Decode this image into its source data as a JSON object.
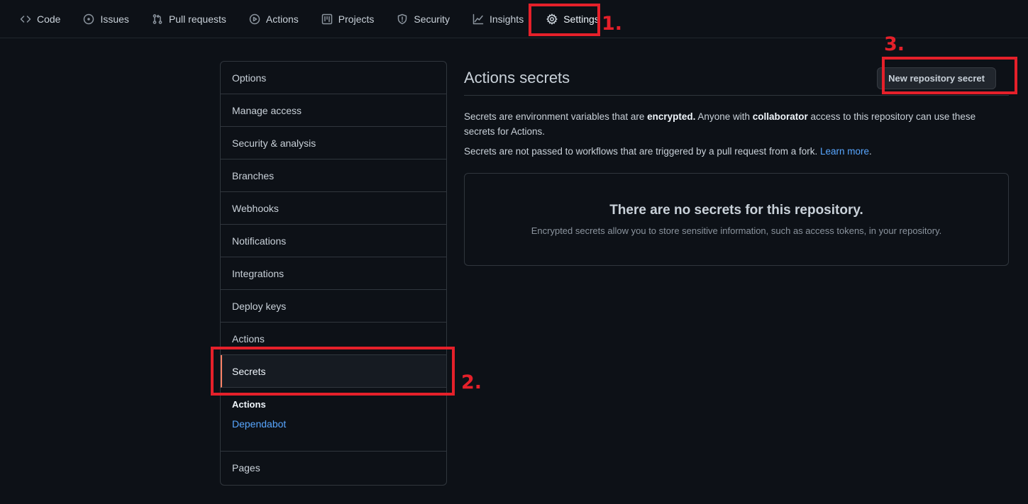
{
  "nav": {
    "tabs": [
      {
        "label": "Code",
        "icon": "code-icon"
      },
      {
        "label": "Issues",
        "icon": "issue-icon"
      },
      {
        "label": "Pull requests",
        "icon": "pull-request-icon"
      },
      {
        "label": "Actions",
        "icon": "play-icon"
      },
      {
        "label": "Projects",
        "icon": "project-icon"
      },
      {
        "label": "Security",
        "icon": "shield-icon"
      },
      {
        "label": "Insights",
        "icon": "graph-icon"
      },
      {
        "label": "Settings",
        "icon": "gear-icon",
        "active": true
      }
    ]
  },
  "annotations": {
    "step1": "1.",
    "step2": "2.",
    "step3": "3.",
    "color": "#e5202a"
  },
  "sidebar": {
    "items": [
      {
        "label": "Options"
      },
      {
        "label": "Manage access"
      },
      {
        "label": "Security & analysis"
      },
      {
        "label": "Branches"
      },
      {
        "label": "Webhooks"
      },
      {
        "label": "Notifications"
      },
      {
        "label": "Integrations"
      },
      {
        "label": "Deploy keys"
      },
      {
        "label": "Actions"
      },
      {
        "label": "Secrets",
        "selected": true
      }
    ],
    "group": {
      "title": "Actions",
      "sub": "Dependabot"
    },
    "last_item": "Pages"
  },
  "main": {
    "title": "Actions secrets",
    "new_button": "New repository secret",
    "desc": {
      "part1": "Secrets are environment variables that are ",
      "bold1": "encrypted.",
      "part2": " Anyone with ",
      "bold2": "collaborator",
      "part3": " access to this repository can use these secrets for Actions."
    },
    "desc2": {
      "text": "Secrets are not passed to workflows that are triggered by a pull request from a fork. ",
      "link": "Learn more"
    },
    "blank": {
      "title": "There are no secrets for this repository.",
      "subtitle": "Encrypted secrets allow you to store sensitive information, such as access tokens, in your repository."
    }
  },
  "colors": {
    "background": "#0d1117",
    "border": "#30363d",
    "link": "#58a6ff",
    "selected_accent": "#f78166"
  }
}
